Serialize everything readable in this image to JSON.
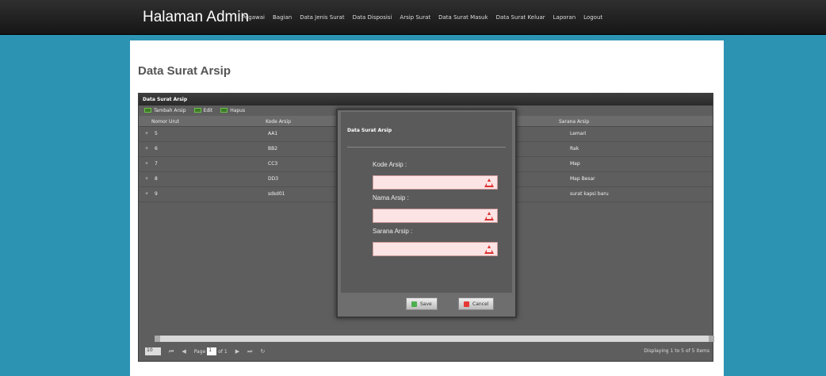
{
  "header": {
    "brand": "Halaman Admin",
    "nav": [
      "Pegawai",
      "Bagian",
      "Data Jenis Surat",
      "Data Disposisi",
      "Arsip Surat",
      "Data Surat Masuk",
      "Data Surat Keluar",
      "Laporan",
      "Logout"
    ]
  },
  "page": {
    "title": "Data Surat Arsip"
  },
  "panel": {
    "title": "Data Surat Arsip",
    "toolbar": {
      "add": "Tambah Arsip",
      "edit": "Edit",
      "delete": "Hapus"
    },
    "columns": [
      "Nomor Urut",
      "Kode Arsip",
      "Sarana Arsip"
    ],
    "rows": [
      {
        "no": "5",
        "kode": "AA1",
        "sarana": "Lemari"
      },
      {
        "no": "6",
        "kode": "BB2",
        "sarana": "Rak"
      },
      {
        "no": "7",
        "kode": "CC3",
        "sarana": "Map"
      },
      {
        "no": "8",
        "kode": "DD3",
        "sarana": "Map Besar"
      },
      {
        "no": "9",
        "kode": "sdsd01",
        "sarana": "surat kapsi baru"
      }
    ],
    "pager": {
      "page_size": "10",
      "page_label": "Page",
      "page_value": "1",
      "of_label": "of 1",
      "info": "Displaying 1 to 5 of 5 items"
    }
  },
  "modal": {
    "title": "Data Surat Arsip",
    "fields": [
      {
        "label": "Kode Arsip :",
        "value": ""
      },
      {
        "label": "Nama Arsip :",
        "value": ""
      },
      {
        "label": "Sarana Arsip :",
        "value": ""
      }
    ],
    "save_label": "Save",
    "cancel_label": "Cancel"
  },
  "colors": {
    "background": "#2c93b3",
    "topbar": "#1f1f1f",
    "panel": "#5e5e5e",
    "invalid_input": "#fde4e4",
    "warning": "#dd3333",
    "tb_icon": "#3f7a28"
  },
  "icons": {
    "toolbar": "add-icon",
    "field": "warning-icon",
    "save": "check-icon",
    "cancel": "cancel-icon",
    "refresh": "refresh-icon"
  }
}
